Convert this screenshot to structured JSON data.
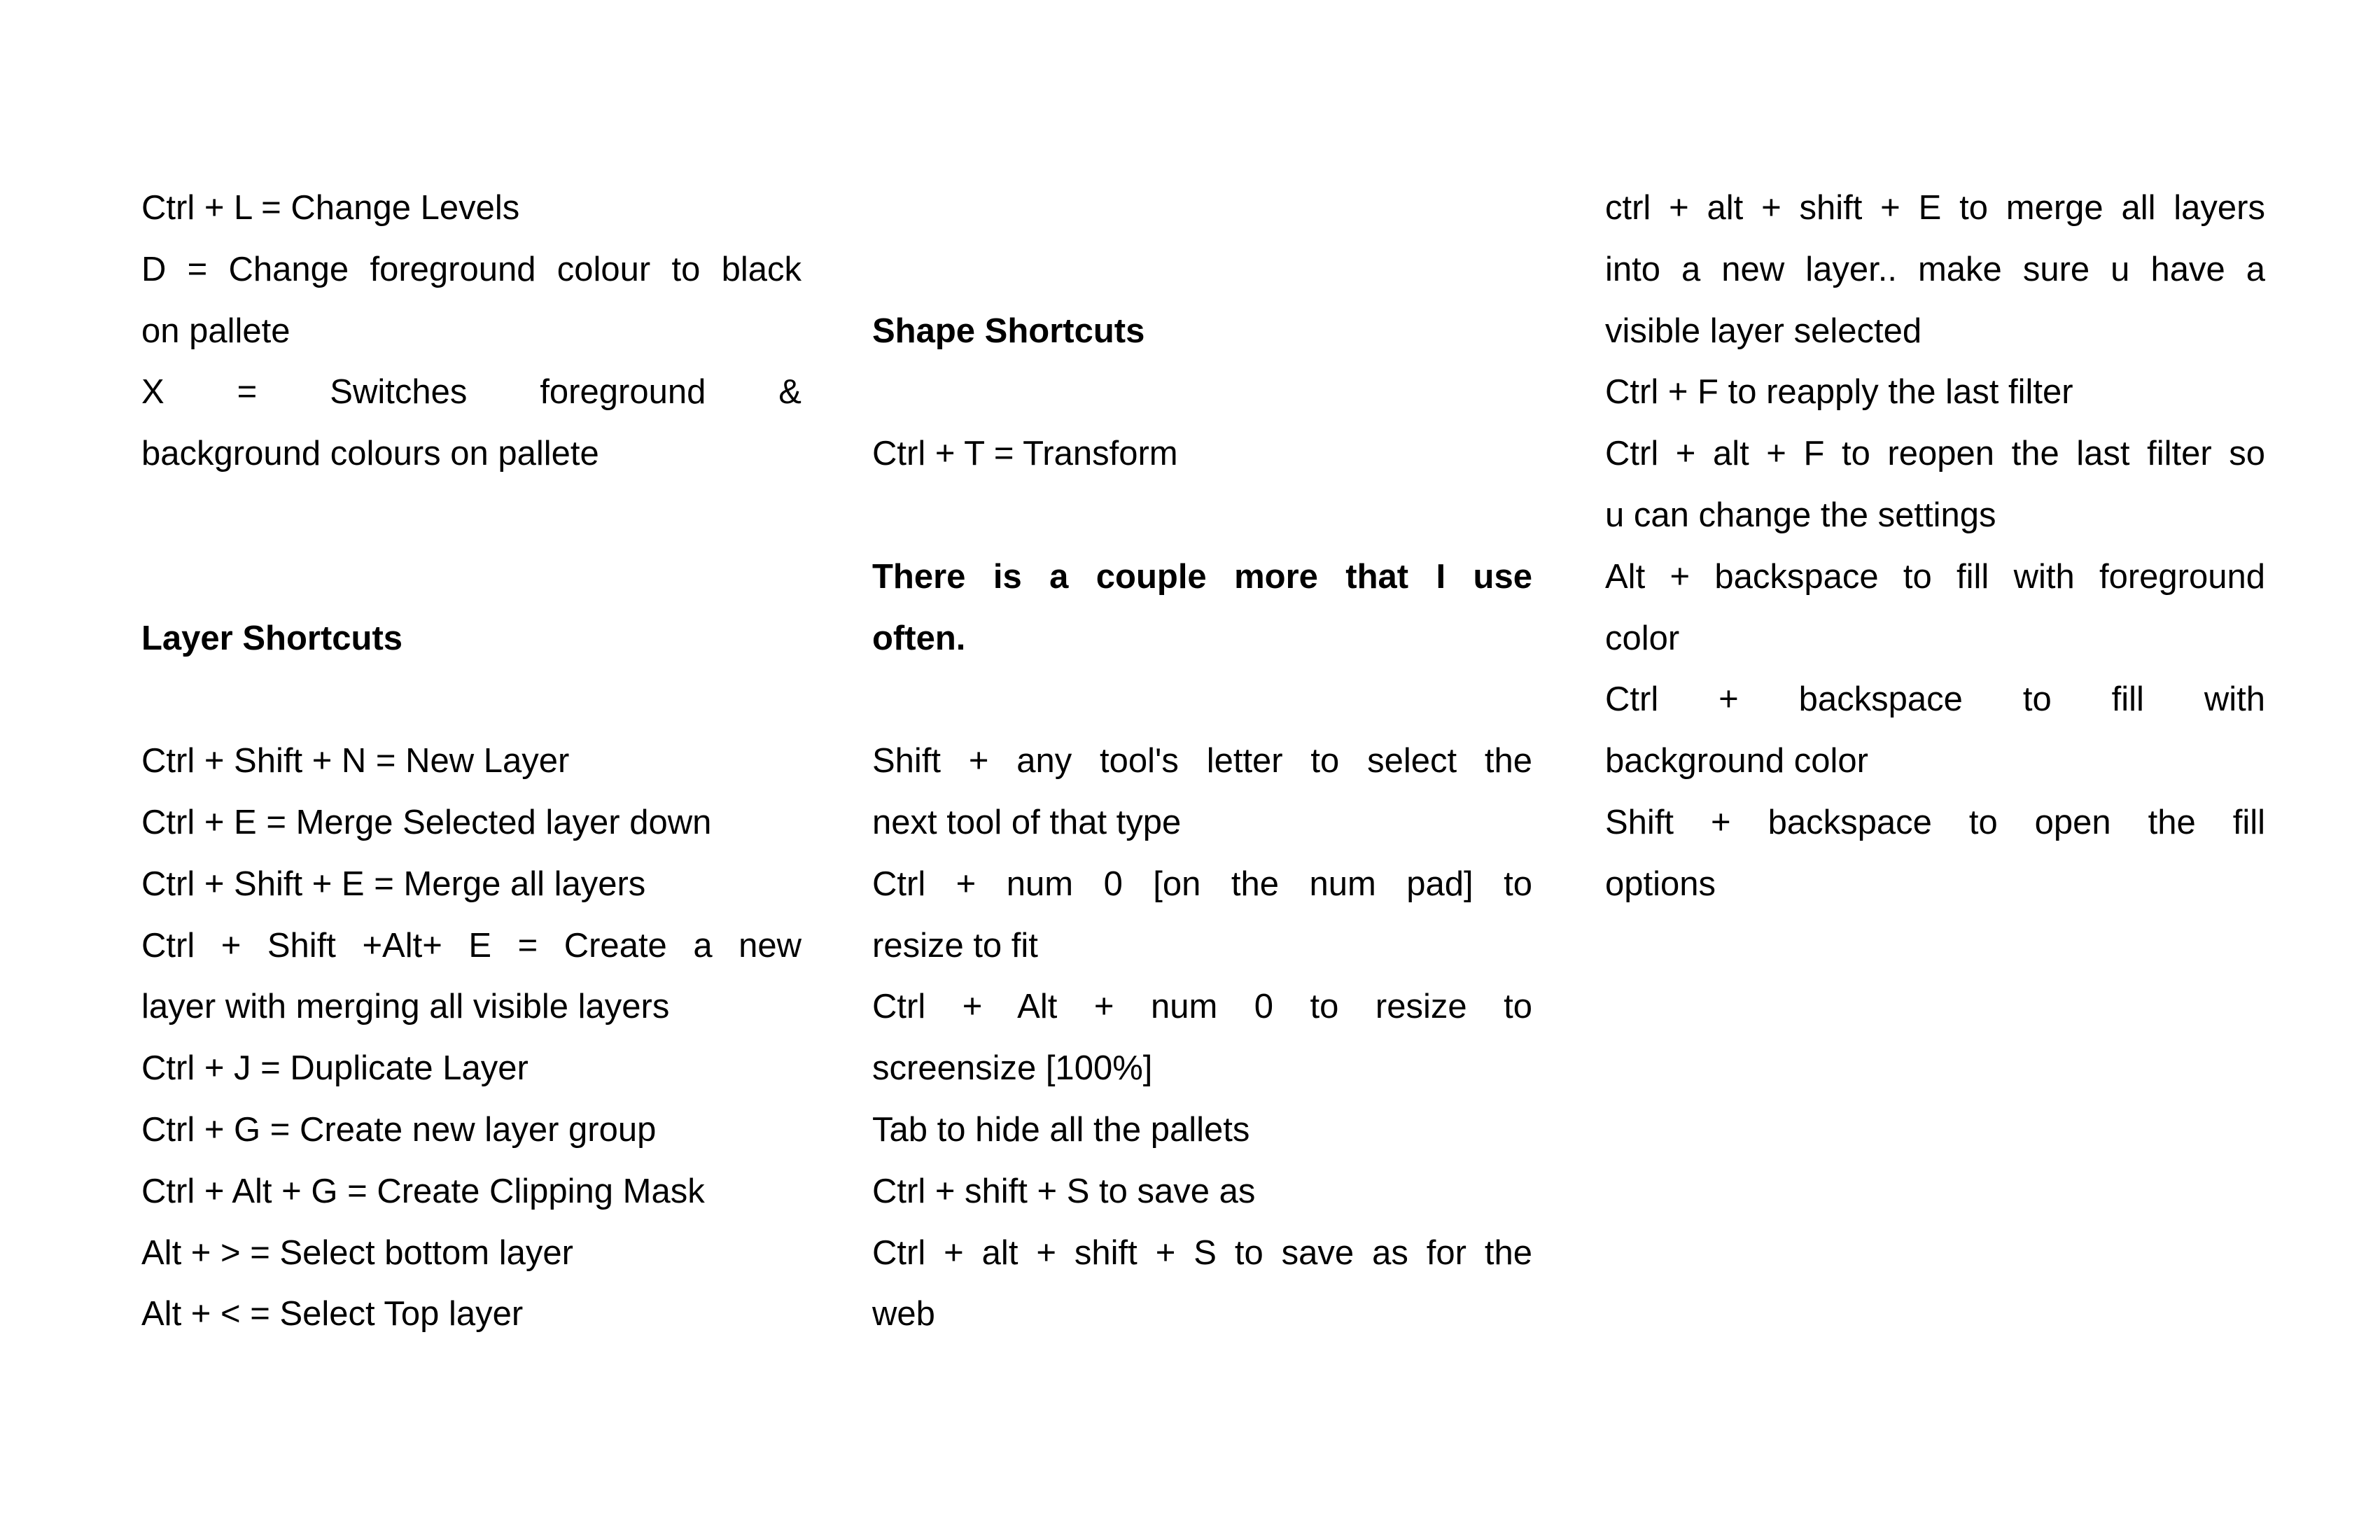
{
  "columns": [
    {
      "blocks": [
        {
          "type": "para",
          "lines": [
            "Ctrl + L = Change Levels"
          ]
        },
        {
          "type": "para",
          "lines": [
            "D = Change foreground colour to black",
            "on pallete"
          ]
        },
        {
          "type": "para",
          "lines": [
            "X = Switches foreground &",
            "background colours on pallete"
          ]
        },
        {
          "type": "blank"
        },
        {
          "type": "blank"
        },
        {
          "type": "heading",
          "lines": [
            "Layer Shortcuts"
          ]
        },
        {
          "type": "blank"
        },
        {
          "type": "para",
          "lines": [
            "Ctrl + Shift + N = New Layer"
          ]
        },
        {
          "type": "para",
          "lines": [
            "Ctrl + E = Merge Selected layer down"
          ]
        },
        {
          "type": "para",
          "lines": [
            "Ctrl + Shift + E = Merge all layers"
          ]
        },
        {
          "type": "para",
          "lines": [
            "Ctrl + Shift +Alt+ E = Create a new",
            "layer with merging all visible layers"
          ]
        },
        {
          "type": "para",
          "lines": [
            "Ctrl + J = Duplicate Layer"
          ]
        },
        {
          "type": "para",
          "lines": [
            "Ctrl + G = Create new layer group"
          ]
        },
        {
          "type": "para",
          "lines": [
            "Ctrl + Alt + G = Create Clipping Mask"
          ]
        },
        {
          "type": "para",
          "lines": [
            "Alt + > = Select bottom layer"
          ]
        },
        {
          "type": "para",
          "lines": [
            "Alt + < = Select Top layer"
          ]
        }
      ]
    },
    {
      "blocks": [
        {
          "type": "blank"
        },
        {
          "type": "blank"
        },
        {
          "type": "heading",
          "lines": [
            "Shape Shortcuts"
          ]
        },
        {
          "type": "blank"
        },
        {
          "type": "para",
          "lines": [
            "Ctrl + T = Transform"
          ]
        },
        {
          "type": "blank"
        },
        {
          "type": "heading",
          "lines": [
            "There is a couple more that I use",
            "often."
          ]
        },
        {
          "type": "blank"
        },
        {
          "type": "para",
          "lines": [
            "Shift + any tool's letter to select the",
            "next tool of that type"
          ]
        },
        {
          "type": "para",
          "lines": [
            "Ctrl + num 0 [on the num pad] to",
            "resize to fit"
          ]
        },
        {
          "type": "para",
          "lines": [
            "Ctrl + Alt + num 0 to resize to",
            "screensize [100%]"
          ]
        },
        {
          "type": "para",
          "lines": [
            "Tab to hide all the pallets"
          ]
        },
        {
          "type": "para",
          "lines": [
            "Ctrl + shift + S to save as"
          ]
        },
        {
          "type": "para",
          "lines": [
            "Ctrl + alt + shift + S to save as for the",
            "web"
          ]
        }
      ]
    },
    {
      "blocks": [
        {
          "type": "para",
          "lines": [
            "ctrl + alt + shift + E to merge all layers",
            "into a new layer.. make sure u have a",
            "visible layer selected"
          ]
        },
        {
          "type": "para",
          "lines": [
            "Ctrl + F to reapply the last filter"
          ]
        },
        {
          "type": "para",
          "lines": [
            "Ctrl + alt + F to reopen the last filter so",
            "u can change the settings"
          ]
        },
        {
          "type": "para",
          "lines": [
            "Alt + backspace to fill with foreground",
            "color"
          ]
        },
        {
          "type": "para",
          "lines": [
            "Ctrl + backspace to fill with",
            "background color"
          ]
        },
        {
          "type": "para",
          "lines": [
            "Shift + backspace to open the fill",
            "options"
          ]
        }
      ]
    }
  ]
}
